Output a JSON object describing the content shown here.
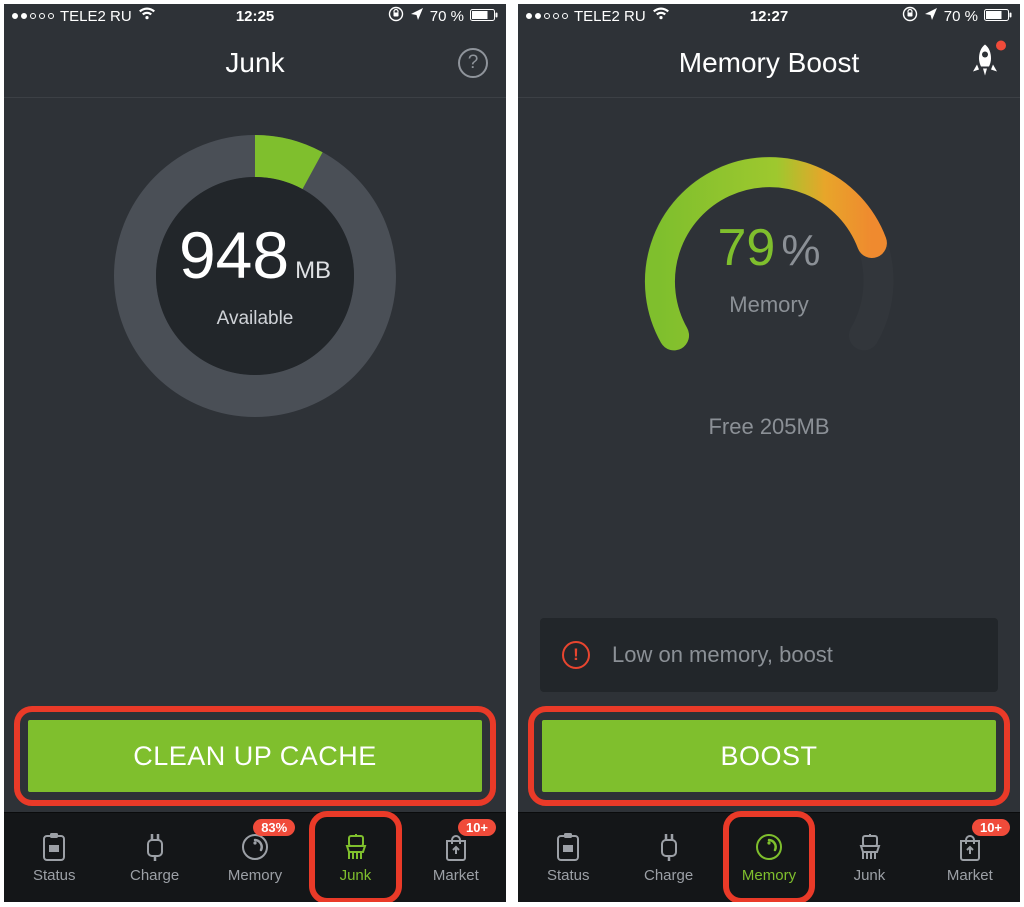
{
  "left": {
    "statusbar": {
      "carrier": "TELE2 RU",
      "time": "12:25",
      "battery": "70 %"
    },
    "header": {
      "title": "Junk"
    },
    "junk": {
      "value": "948",
      "unit": "MB",
      "available": "Available",
      "used_pct": 8
    },
    "cta": "CLEAN UP CACHE",
    "tabs": {
      "items": [
        {
          "label": "Status"
        },
        {
          "label": "Charge"
        },
        {
          "label": "Memory",
          "badge": "83%"
        },
        {
          "label": "Junk"
        },
        {
          "label": "Market",
          "badge": "10+"
        }
      ],
      "active": 3
    }
  },
  "right": {
    "statusbar": {
      "carrier": "TELE2 RU",
      "time": "12:27",
      "battery": "70 %"
    },
    "header": {
      "title": "Memory Boost"
    },
    "memory": {
      "pct_value": "79",
      "pct_sign": "%",
      "label": "Memory",
      "free": "Free 205MB",
      "used_pct": 79
    },
    "warning": "Low on memory, boost",
    "cta": "BOOST",
    "tabs": {
      "items": [
        {
          "label": "Status"
        },
        {
          "label": "Charge"
        },
        {
          "label": "Memory"
        },
        {
          "label": "Junk"
        },
        {
          "label": "Market",
          "badge": "10+"
        }
      ],
      "active": 2
    }
  },
  "chart_data": [
    {
      "type": "pie",
      "title": "Junk — storage available",
      "series": [
        {
          "name": "Used segment",
          "value": 8
        },
        {
          "name": "Remaining ring",
          "value": 92
        }
      ],
      "center_value": "948 MB Available"
    },
    {
      "type": "pie",
      "title": "Memory usage gauge",
      "series": [
        {
          "name": "Used",
          "value": 79
        },
        {
          "name": "Free",
          "value": 21
        }
      ],
      "annotation": "Free 205MB"
    }
  ]
}
